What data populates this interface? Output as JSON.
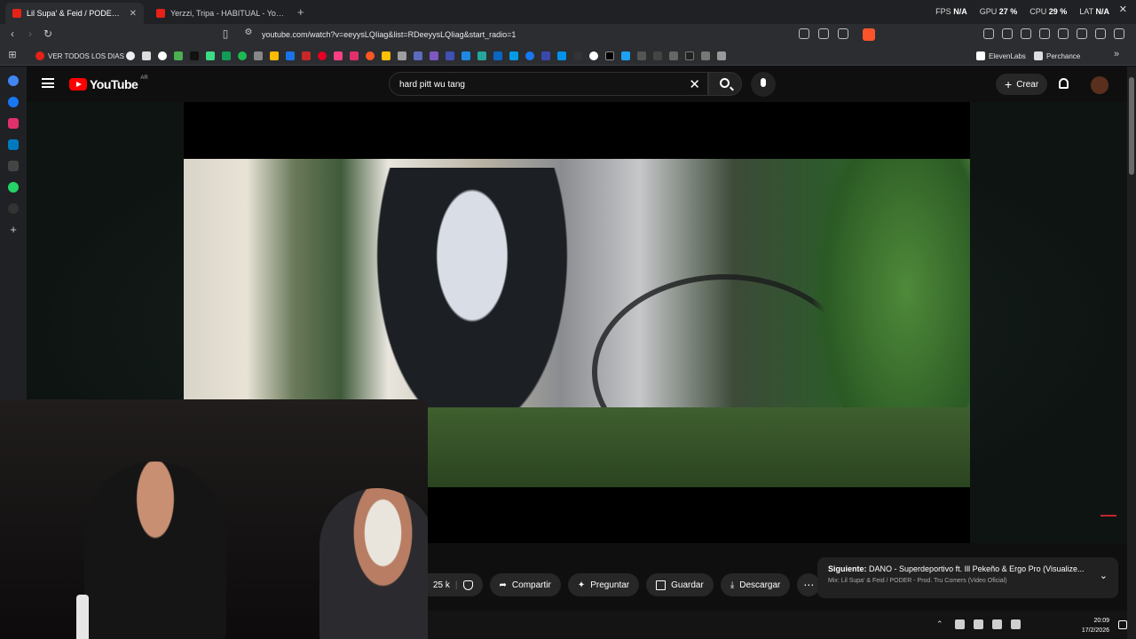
{
  "browser": {
    "tabs": [
      {
        "title": "Lil Supa' & Feid / PODER - Pr",
        "active": true
      },
      {
        "title": "Yerzzi, Tripa - HABITUAL - YouTube",
        "active": false
      }
    ],
    "stats": {
      "fps_label": "FPS",
      "fps": "N/A",
      "gpu_label": "GPU",
      "gpu": "27 %",
      "cpu_label": "CPU",
      "cpu": "29 %",
      "lat_label": "LAT",
      "lat": "N/A"
    },
    "url": "youtube.com/watch?v=eeyysLQIiag&list=RDeeyysLQIiag&start_radio=1",
    "bookmarks": {
      "all_label": "VER TODOS LOS DIAS",
      "elevenlabs": "ElevenLabs",
      "perchance": "Perchance"
    }
  },
  "youtube": {
    "logo": "YouTube",
    "country": "AR",
    "search_query": "hard pitt  wu tang",
    "create_label": "Crear"
  },
  "actions": {
    "likes": "25 k",
    "share": "Compartir",
    "ask": "Preguntar",
    "save": "Guardar",
    "download": "Descargar"
  },
  "upnext": {
    "label": "Siguiente:",
    "title": "DANO - Superdeportivo ft. Ill Pekeño & Ergo Pro (Visualize...",
    "mix": "Mix: Lil Supa' & Feid / PODER - Prod. Tru Comers (Video Oficial)"
  },
  "taskbar": {
    "time": "20:09",
    "date": "17/2/2026"
  },
  "colors": {
    "accent": "#ff0000",
    "background": "#0f0f0f",
    "pill": "#272727"
  }
}
